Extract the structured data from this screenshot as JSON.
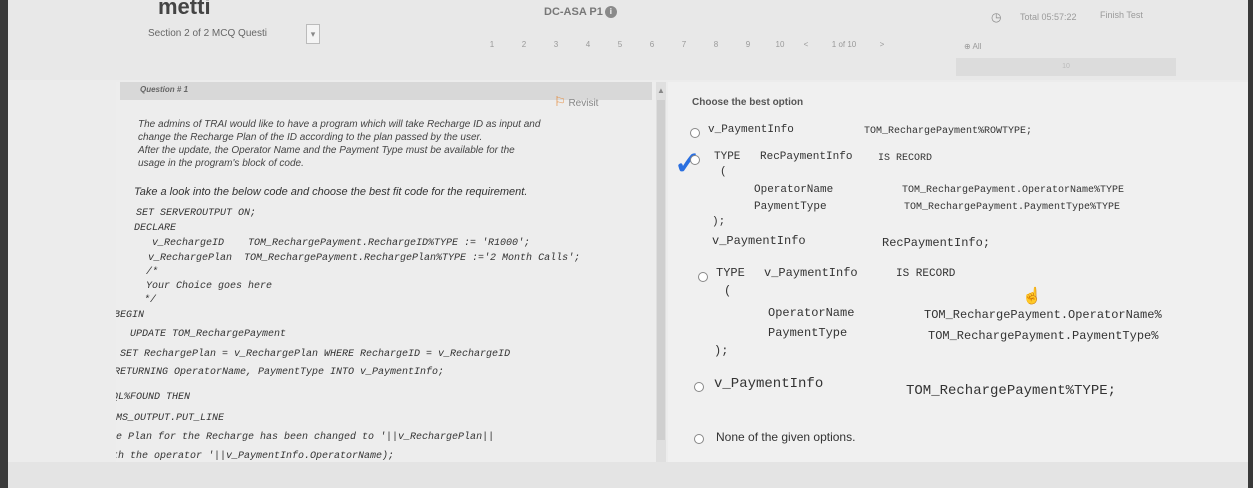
{
  "header": {
    "brand": "metti",
    "section_label": "Section 2 of 2   MCQ Questi",
    "exam_code": "DC-ASA P1",
    "timer": "Total 05:57:22",
    "finish_label": "Finish Test",
    "pages": [
      "1",
      "2",
      "3",
      "4",
      "5",
      "6",
      "7",
      "8",
      "9",
      "10"
    ],
    "page_prev": "<",
    "page_indicator": "1 of 10",
    "page_next": ">",
    "all_label": "All",
    "progress": "10"
  },
  "question": {
    "title": "Question # 1",
    "revisit_label": "Revisit",
    "text_lines": [
      "The admins of TRAI would like to have a program which will take Recharge ID as input and",
      "change the Recharge Plan of the ID according to the plan passed by the user.",
      "After the update, the Operator Name and the Payment Type must be available for the",
      "usage in the program's block of code."
    ],
    "instruction": "Take a look into the below code and choose the best fit code for the requirement.",
    "code": {
      "l1": "SET SERVEROUTPUT ON;",
      "l2": "DECLARE",
      "l3": "v_RechargeID    TOM_RechargePayment.RechargeID%TYPE := 'R1000';",
      "l4": "v_RechargePlan  TOM_RechargePayment.RechargePlan%TYPE :='2 Month Calls';",
      "l5": "/*",
      "l6": "Your Choice goes here",
      "l7": "*/",
      "l8": "BEGIN",
      "l9": "UPDATE TOM_RechargePayment",
      "l10": "SET RechargePlan = v_RechargePlan WHERE RechargeID = v_RechargeID",
      "l11": "RETURNING OperatorName, PaymentType INTO v_PaymentInfo;",
      "l12": "IF SQL%FOUND THEN",
      "l13": "DBMS_OUTPUT.PUT_LINE",
      "l14": "('The Plan for the Recharge has been changed to '||v_RechargePlan||",
      "l15": "' with the operator '||v_PaymentInfo.OperatorName);"
    }
  },
  "answers": {
    "label": "Choose the best option",
    "opt1": {
      "var": "v_PaymentInfo",
      "type": "TOM_RechargePayment%ROWTYPE;"
    },
    "opt2": {
      "line1_kw": "TYPE",
      "line1_name": "RecPaymentInfo",
      "line1_kw2": "IS RECORD",
      "open": "(",
      "f1_name": "OperatorName",
      "f1_type": "TOM_RechargePayment.OperatorName%TYPE",
      "f2_name": "PaymentType",
      "f2_type": "TOM_RechargePayment.PaymentType%TYPE",
      "close": ");",
      "decl_var": "v_PaymentInfo",
      "decl_type": "RecPaymentInfo;"
    },
    "opt3": {
      "line1_kw": "TYPE",
      "line1_name": "v_PaymentInfo",
      "line1_kw2": "IS RECORD",
      "open": "(",
      "f1_name": "OperatorName",
      "f1_type": "TOM_RechargePayment.OperatorName%",
      "f2_name": "PaymentType",
      "f2_type": "TOM_RechargePayment.PaymentType%",
      "close": ");"
    },
    "opt4": {
      "var": "v_PaymentInfo",
      "type": "TOM_RechargePayment%TYPE;"
    },
    "opt5": "None of the given options."
  }
}
